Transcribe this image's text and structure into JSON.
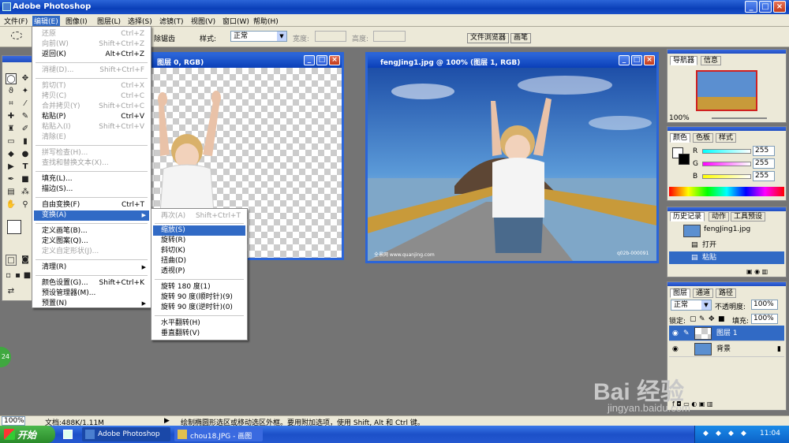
{
  "app": {
    "title": "Adobe Photoshop"
  },
  "menubar": {
    "items": [
      {
        "label": "文件(F)"
      },
      {
        "label": "编辑(E)"
      },
      {
        "label": "图像(I)"
      },
      {
        "label": "图层(L)"
      },
      {
        "label": "选择(S)"
      },
      {
        "label": "滤镜(T)"
      },
      {
        "label": "视图(V)"
      },
      {
        "label": "窗口(W)"
      },
      {
        "label": "帮助(H)"
      }
    ]
  },
  "options": {
    "remove_aliasing": "除锯齿",
    "style_label": "样式:",
    "style_value": "正常",
    "width_label": "宽度:",
    "height_label": "高度:",
    "tab_file_browser": "文件浏览器",
    "tab_brushes": "画笔"
  },
  "edit_menu": {
    "items": [
      {
        "label": "还原",
        "shortcut": "Ctrl+Z",
        "disabled": true
      },
      {
        "label": "向前(W)",
        "shortcut": "Shift+Ctrl+Z",
        "disabled": true
      },
      {
        "label": "返回(K)",
        "shortcut": "Alt+Ctrl+Z",
        "disabled": false
      },
      {
        "label": "消褪(D)...",
        "shortcut": "Shift+Ctrl+F",
        "disabled": true
      },
      {
        "label": "剪切(T)",
        "shortcut": "Ctrl+X",
        "disabled": true
      },
      {
        "label": "拷贝(C)",
        "shortcut": "Ctrl+C",
        "disabled": true
      },
      {
        "label": "合并拷贝(Y)",
        "shortcut": "Shift+Ctrl+C",
        "disabled": true
      },
      {
        "label": "粘贴(P)",
        "shortcut": "Ctrl+V",
        "disabled": false
      },
      {
        "label": "粘贴入(I)",
        "shortcut": "Shift+Ctrl+V",
        "disabled": true
      },
      {
        "label": "清除(E)",
        "shortcut": "",
        "disabled": true
      },
      {
        "label": "拼写检查(H)...",
        "shortcut": "",
        "disabled": true
      },
      {
        "label": "查找和替换文本(X)...",
        "shortcut": "",
        "disabled": true
      },
      {
        "label": "填充(L)...",
        "shortcut": "",
        "disabled": false
      },
      {
        "label": "描边(S)...",
        "shortcut": "",
        "disabled": false
      },
      {
        "label": "自由变换(F)",
        "shortcut": "Ctrl+T",
        "disabled": false
      },
      {
        "label": "变换(A)",
        "shortcut": "",
        "disabled": false
      },
      {
        "label": "定义画笔(B)...",
        "shortcut": "",
        "disabled": false
      },
      {
        "label": "定义图案(Q)...",
        "shortcut": "",
        "disabled": false
      },
      {
        "label": "定义自定形状(J)...",
        "shortcut": "",
        "disabled": true
      },
      {
        "label": "清理(R)",
        "shortcut": "",
        "disabled": false
      },
      {
        "label": "颜色设置(G)...",
        "shortcut": "Shift+Ctrl+K",
        "disabled": false
      },
      {
        "label": "预设管理器(M)...",
        "shortcut": "",
        "disabled": false
      },
      {
        "label": "预置(N)",
        "shortcut": "",
        "disabled": false
      }
    ]
  },
  "transform_menu": {
    "items": [
      {
        "label": "再次(A)",
        "shortcut": "Shift+Ctrl+T"
      },
      {
        "label": "缩放(S)"
      },
      {
        "label": "旋转(R)"
      },
      {
        "label": "斜切(K)"
      },
      {
        "label": "扭曲(D)"
      },
      {
        "label": "透视(P)"
      },
      {
        "label": "旋转 180 度(1)"
      },
      {
        "label": "旋转 90 度(顺时针)(9)"
      },
      {
        "label": "旋转 90 度(逆时针)(0)"
      },
      {
        "label": "水平翻转(H)"
      },
      {
        "label": "垂直翻转(V)"
      }
    ]
  },
  "doc_left": {
    "title": "图层 0, RGB)"
  },
  "doc_right": {
    "title": "fengJing1.jpg @ 100% (图层 1, RGB)",
    "watermark_left": "全景网 www.quanjing.com",
    "watermark_right": "q02b-000091"
  },
  "navigator": {
    "tab_navigator": "导航器",
    "tab_info": "信息",
    "zoom": "100%"
  },
  "color_panel": {
    "tab_color": "颜色",
    "tab_swatches": "色板",
    "tab_styles": "样式",
    "r_label": "R",
    "g_label": "G",
    "b_label": "B",
    "r": "255",
    "g": "255",
    "b": "255"
  },
  "history": {
    "tab_history": "历史记录",
    "tab_actions": "动作",
    "tab_presets": "工具预设",
    "snapshot": "fengJing1.jpg",
    "steps": [
      {
        "label": "打开"
      },
      {
        "label": "粘贴"
      }
    ]
  },
  "layers": {
    "tab_layers": "图层",
    "tab_channels": "通道",
    "tab_paths": "路径",
    "blend_mode": "正常",
    "opacity_label": "不透明度:",
    "opacity": "100%",
    "lock_label": "锁定:",
    "fill_label": "填充:",
    "fill": "100%",
    "items": [
      {
        "name": "图层 1"
      },
      {
        "name": "背景"
      }
    ]
  },
  "statusbar": {
    "zoom": "100%",
    "doc": "文档:488K/1.11M",
    "hint": "绘制椭圆形选区或移动选区外框。要用附加选项，使用 Shift, Alt 和 Ctrl 键。"
  },
  "taskbar": {
    "start": "开始",
    "items": [
      {
        "label": "Adobe Photoshop"
      },
      {
        "label": "chou18.JPG - 画图"
      }
    ],
    "clock": "11:04"
  },
  "badge": "24",
  "baidu": {
    "logo": "Bai 经验",
    "url": "jingyan.baidu.com"
  }
}
